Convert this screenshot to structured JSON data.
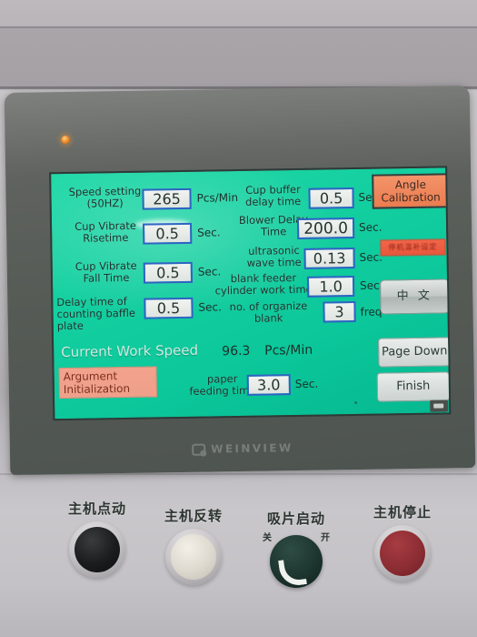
{
  "device": {
    "brand": "WEINVIEW",
    "power_led": "power-led"
  },
  "screen": {
    "left_params": [
      {
        "label": "Speed setting\n(50HZ)",
        "value": "265",
        "unit": "Pcs/Min",
        "align": "center"
      },
      {
        "label": "Cup Vibrate\nRisetime",
        "value": "0.5",
        "unit": "Sec.",
        "align": "center"
      },
      {
        "label": "Cup Vibrate\nFall Time",
        "value": "0.5",
        "unit": "Sec.",
        "align": "center"
      },
      {
        "label": "Delay time of\ncounting baffle\nplate",
        "value": "0.5",
        "unit": "Sec.",
        "align": "left"
      }
    ],
    "right_params": [
      {
        "label": "Cup buffer\ndelay time",
        "value": "0.5",
        "unit": "Sec."
      },
      {
        "label": "Blower Delay\nTime",
        "value": "200.0",
        "unit": "Sec."
      },
      {
        "label": "ultrasonic\nwave time",
        "value": "0.13",
        "unit": "Sec."
      },
      {
        "label": "blank feeder\ncylinder work time",
        "value": "1.0",
        "unit": "Sec."
      },
      {
        "label": "no. of organize\nblank",
        "value": "3",
        "unit": "freq"
      }
    ],
    "current_speed": {
      "label": "Current Work Speed",
      "value": "96.3",
      "unit": "Pcs/Min"
    },
    "paper_feeding": {
      "label": "paper\nfeeding time",
      "value": "3.0",
      "unit": "Sec."
    },
    "buttons": {
      "angle_calibration": "Angle\nCalibration",
      "chinese_setting": "停机温补设定",
      "language": "中 文",
      "page_down": "Page Down",
      "finish": "Finish",
      "argument_init": "Argument\nInitialization"
    },
    "colors": {
      "lcd_green": "#11cfa0",
      "field_border": "#2f63c4",
      "orange_button": "#ea7c4f",
      "red_button": "#e8573c",
      "salmon_button": "#f0a18b"
    }
  },
  "controls": [
    {
      "label": "主机点动",
      "type": "push-button",
      "cap": "black"
    },
    {
      "label": "主机反转",
      "type": "push-button",
      "cap": "white"
    },
    {
      "label": "吸片启动",
      "type": "selector-knob",
      "off": "关",
      "on": "开"
    },
    {
      "label": "主机停止",
      "type": "push-button",
      "cap": "red"
    }
  ]
}
